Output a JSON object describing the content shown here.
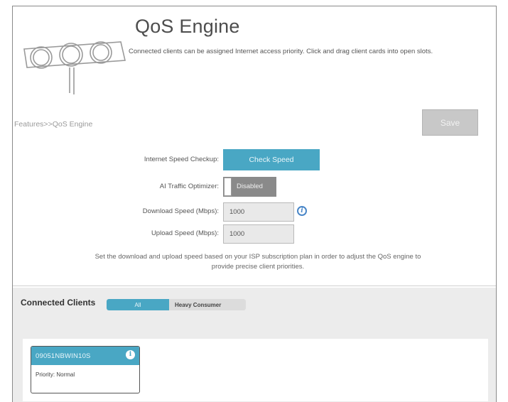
{
  "header": {
    "title": "QoS Engine",
    "description": "Connected clients can be assigned Internet access priority. Click and drag client cards into open slots."
  },
  "breadcrumb": "Features>>QoS Engine",
  "toolbar": {
    "save_label": "Save"
  },
  "settings": {
    "speed_checkup": {
      "label": "Internet Speed Checkup:",
      "button": "Check Speed"
    },
    "ai_optimizer": {
      "label": "AI Traffic Optimizer:",
      "state": "Disabled"
    },
    "download": {
      "label": "Download Speed (Mbps):",
      "value": "1000"
    },
    "upload": {
      "label": "Upload Speed (Mbps):",
      "value": "1000"
    },
    "note": "Set the download and upload speed based on your ISP subscription plan in order to adjust the QoS engine to provide precise client priorities."
  },
  "clients": {
    "title": "Connected Clients",
    "filters": [
      "All",
      "Heavy Consumer"
    ],
    "active_filter": "All",
    "cards": [
      {
        "name": "09051NBWIN10S",
        "priority": "Priority: Normal"
      }
    ]
  },
  "colors": {
    "accent": "#49a7c4",
    "toggle_off": "#8a8a8a",
    "info_blue": "#4a87c8",
    "disabled_button": "#c8c8c8"
  },
  "icons": {
    "logo": "traffic-lights-logo",
    "speed_info": "info-icon",
    "card_info": "info-icon"
  }
}
